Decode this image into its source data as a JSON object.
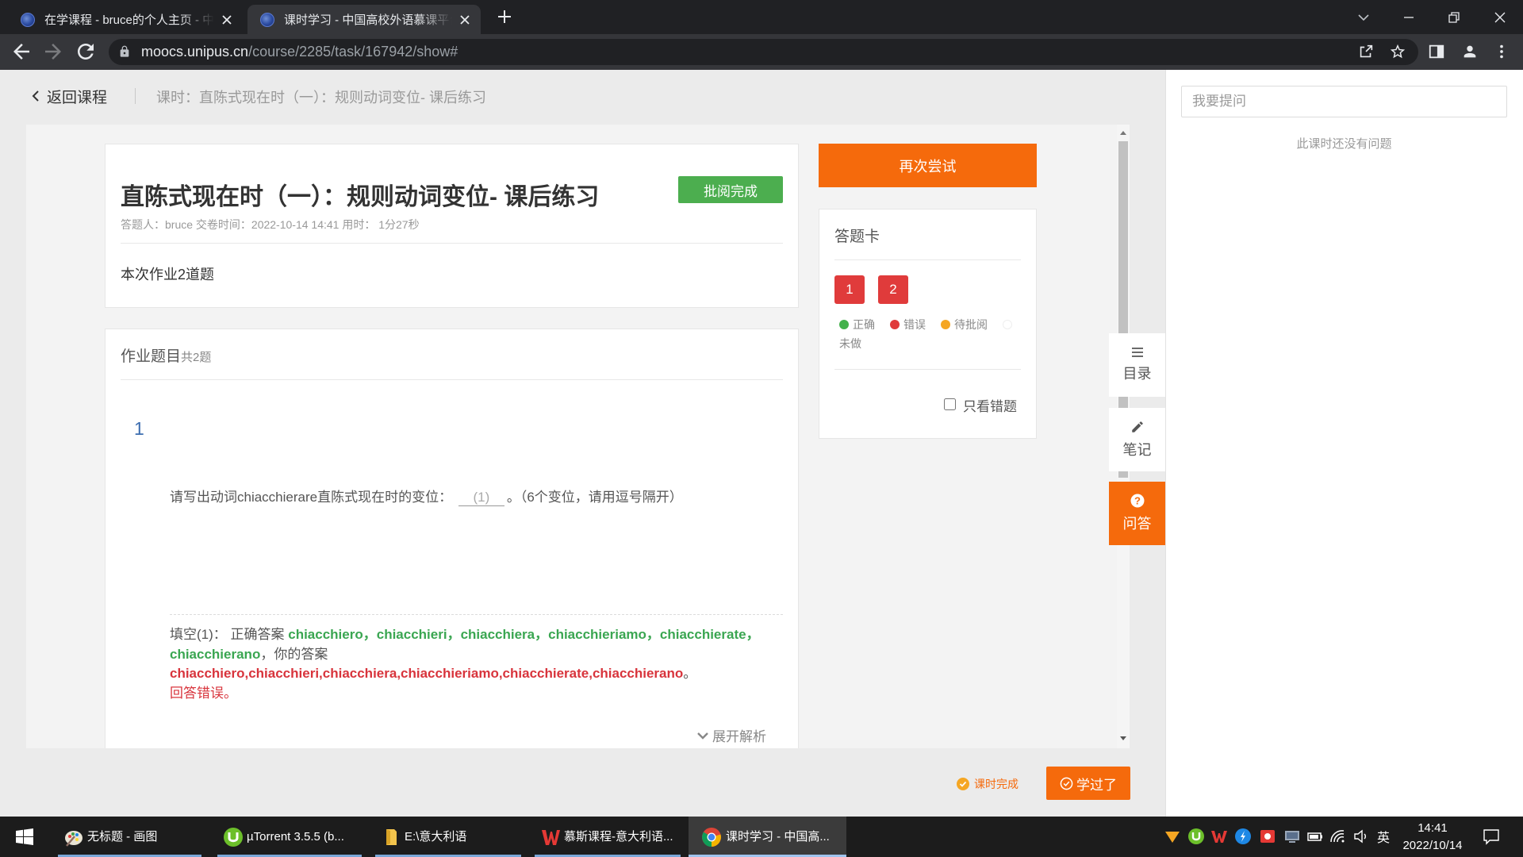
{
  "browser": {
    "tabs": [
      {
        "title": "在学课程 - bruce的个人主页 - 中",
        "active": false
      },
      {
        "title": "课时学习 - 中国高校外语慕课平台",
        "active": true
      }
    ],
    "address": {
      "host": "moocs.unipus.cn",
      "path": "/course/2285/task/167942/show#"
    }
  },
  "theme": {
    "accent": "#f56a0c",
    "success": "#4cae4f",
    "error": "#e03b3b",
    "pending": "#f5a623",
    "number_color": "#3d6eb0",
    "answer_correct_color": "#3aa651",
    "answer_wrong_color": "#d8343c"
  },
  "breadcrumb": {
    "back_label": "返回课程",
    "lesson_label": "课时：直陈式现在时（一）：规则动词变位- 课后练习"
  },
  "summary": {
    "title": "直陈式现在时（一）：规则动词变位- 课后练习",
    "status_badge": "批阅完成",
    "meta": "答题人：bruce 交卷时间：2022-10-14 14:41 用时： 1分27秒",
    "count_text": "本次作业2道题"
  },
  "assignment": {
    "heading": "作业题目",
    "count_label": "共2题",
    "questions": [
      {
        "number": "1",
        "prompt_before": "请写出动词chiacchierare直陈式现在时的变位：",
        "blank": "(1)",
        "prompt_after": "。（6个变位，请用逗号隔开）",
        "result_label": "填空(1)：",
        "correct_label": "正确答案",
        "correct_answer": "chiacchiero，chiacchieri，chiacchiera，chiacchieriamo，chiacchierate，chiacchierano",
        "your_label": "，你的答案",
        "your_answer": "chiacchiero,chiacchieri,chiacchiera,chiacchieriamo,chiacchierate,chiacchierano",
        "your_end": "。",
        "verdict": "回答错误。"
      }
    ],
    "expand_label": "展开解析"
  },
  "retry_button": "再次尝试",
  "answer_card": {
    "title": "答题卡",
    "numbers": [
      {
        "label": "1",
        "color": "#e03b3b"
      },
      {
        "label": "2",
        "color": "#e03b3b"
      }
    ],
    "legend": [
      {
        "label": "正确",
        "color": "#43b14b"
      },
      {
        "label": "错误",
        "color": "#e03b3b"
      },
      {
        "label": "待批阅",
        "color": "#f5a623"
      },
      {
        "label": "未做",
        "color": "#ffffff"
      }
    ],
    "filter_label": "只看错题",
    "filter_checked": false
  },
  "side_tabs": [
    {
      "label": "目录",
      "icon": "list-icon"
    },
    {
      "label": "笔记",
      "icon": "pencil-icon"
    },
    {
      "label": "问答",
      "icon": "question-circle-icon"
    }
  ],
  "footer": {
    "status_label": "课时完成",
    "done_button": "学过了"
  },
  "qa_panel": {
    "input_placeholder": "我要提问",
    "empty_text": "此课时还没有问题"
  },
  "taskbar": {
    "items": [
      {
        "label": "无标题 - 画图",
        "icon": "paint-icon"
      },
      {
        "label": "µTorrent 3.5.5 (b...",
        "icon": "utorrent-icon"
      },
      {
        "label": "E:\\意大利语",
        "icon": "folder-icon"
      },
      {
        "label": "慕斯课程-意大利语...",
        "icon": "wps-icon"
      },
      {
        "label": "课时学习 - 中国高...",
        "icon": "chrome-icon"
      }
    ],
    "ime": "英",
    "time": "14:41",
    "date": "2022/10/14"
  }
}
